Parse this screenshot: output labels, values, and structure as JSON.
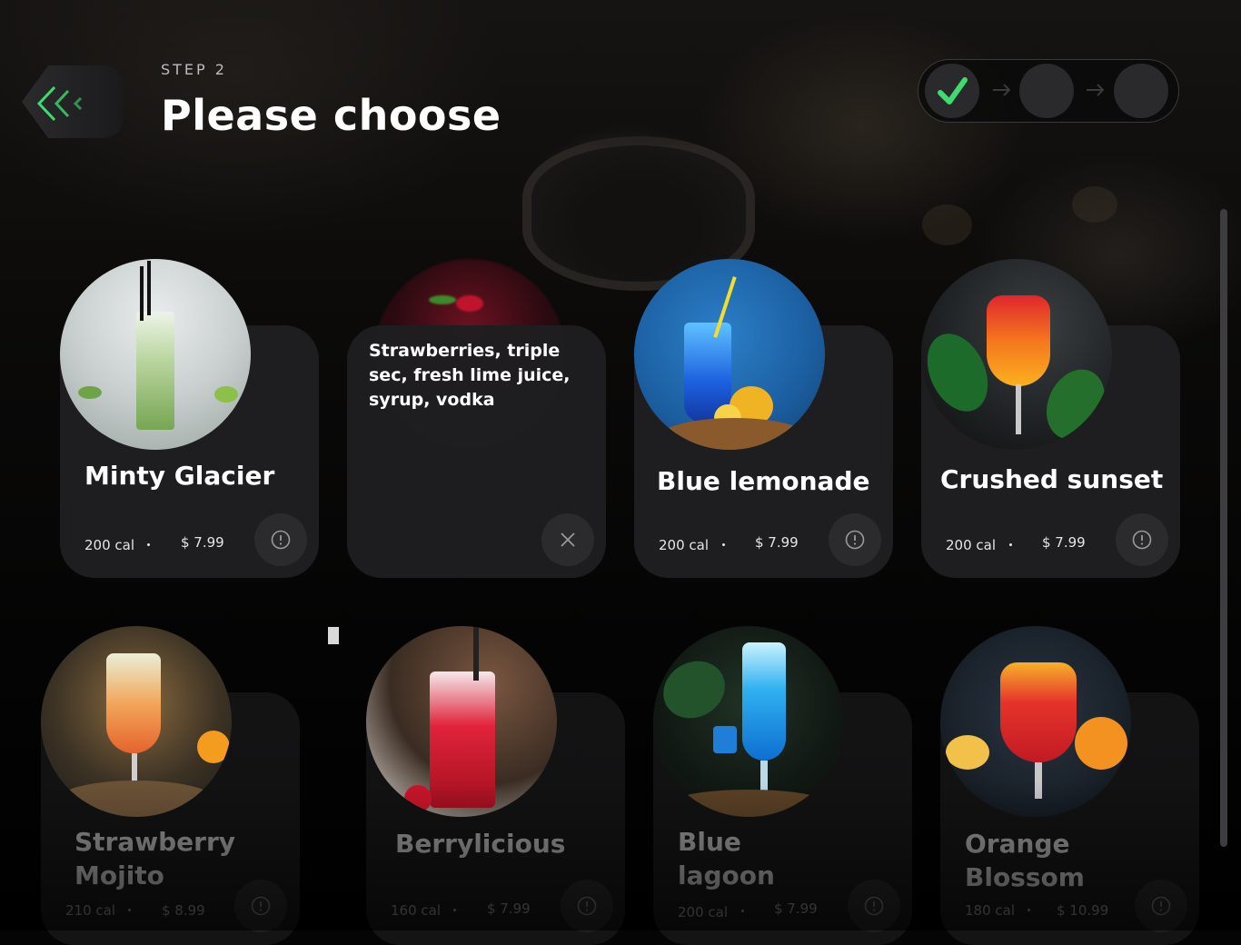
{
  "header": {
    "step_label": "STEP 2",
    "title": "Please choose"
  },
  "stepper": {
    "steps": [
      "completed",
      "pending",
      "pending"
    ]
  },
  "colors": {
    "accent": "#3ddc6e",
    "card": "#1e1e20",
    "button": "#2b2b2e"
  },
  "drinks": [
    {
      "name": "Minty Glacier",
      "calories": "200 cal",
      "price": "$ 7.99",
      "icon": "info-icon"
    },
    {
      "description": "Strawberries, triple sec, fresh lime juice, syrup, vodka",
      "icon": "close-icon"
    },
    {
      "name": "Blue lemonade",
      "calories": "200 cal",
      "price": "$ 7.99",
      "icon": "info-icon"
    },
    {
      "name": "Crushed sunset",
      "calories": "200 cal",
      "price": "$ 7.99",
      "icon": "info-icon"
    },
    {
      "name": "Strawberry Mojito",
      "calories": "210 cal",
      "price": "$ 8.99",
      "icon": "info-icon"
    },
    {
      "name": "Berrylicious",
      "calories": "160 cal",
      "price": "$ 7.99",
      "icon": "info-icon"
    },
    {
      "name": "Blue lagoon",
      "calories": "200 cal",
      "price": "$ 7.99",
      "icon": "info-icon"
    },
    {
      "name": "Orange Blossom",
      "calories": "180 cal",
      "price": "$ 10.99",
      "icon": "info-icon"
    }
  ]
}
